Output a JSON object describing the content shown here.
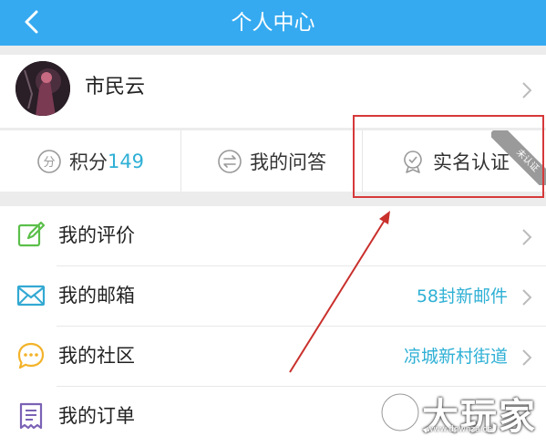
{
  "header": {
    "title": "个人中心",
    "back_icon": "chevron-left-icon"
  },
  "profile": {
    "username": "市民云"
  },
  "stats": [
    {
      "label": "积分",
      "value": "149",
      "icon": "points-icon"
    },
    {
      "label": "我的问答",
      "icon": "qa-icon"
    },
    {
      "label": "实名认证",
      "icon": "verify-icon",
      "badge": "未认证"
    }
  ],
  "menu": [
    {
      "label": "我的评价",
      "icon": "edit-icon",
      "value": ""
    },
    {
      "label": "我的邮箱",
      "icon": "mail-icon",
      "value": "58封新邮件"
    },
    {
      "label": "我的社区",
      "icon": "chat-icon",
      "value": "凉城新村街道"
    },
    {
      "label": "我的订单",
      "icon": "order-icon",
      "value": ""
    }
  ],
  "watermark": {
    "text": "大玩家",
    "url": "www.downza.cn"
  },
  "colors": {
    "header": "#35aaf0",
    "accent": "#2fb0d5",
    "highlight": "#d6393a"
  }
}
